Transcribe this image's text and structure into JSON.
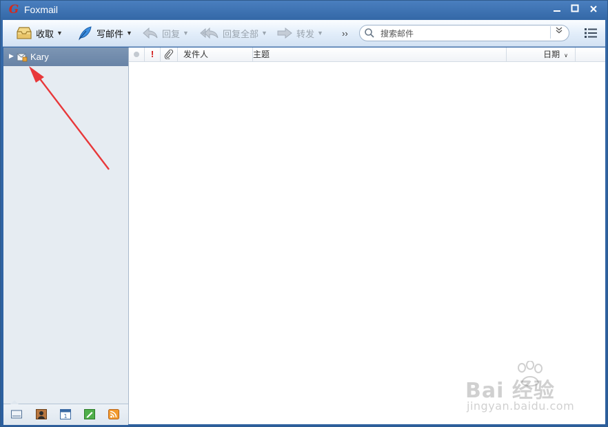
{
  "window": {
    "title": "Foxmail",
    "logo_glyph": "G",
    "controls": {
      "minimize": "▁",
      "maximize": "□",
      "close": "✕"
    }
  },
  "toolbar": {
    "receive": {
      "label": "收取",
      "icon": "inbox-tray-icon"
    },
    "compose": {
      "label": "写邮件",
      "icon": "feather-pen-icon"
    },
    "reply": {
      "label": "回复",
      "icon": "reply-arrow-icon",
      "enabled": false
    },
    "reply_all": {
      "label": "回复全部",
      "icon": "reply-all-arrow-icon",
      "enabled": false
    },
    "forward": {
      "label": "转发",
      "icon": "forward-arrow-icon",
      "enabled": false
    },
    "more": "››",
    "caret": "▼"
  },
  "search": {
    "placeholder": "搜索邮件",
    "value": "",
    "dropdown_glyph": "≽"
  },
  "sidebar": {
    "expander": "▶",
    "account": {
      "name": "Kary",
      "icon": "account-mailbox-icon"
    },
    "bottom_icons": [
      "mail-icon",
      "contacts-icon",
      "calendar-icon",
      "notes-icon",
      "rss-icon"
    ]
  },
  "message_list": {
    "columns": {
      "read": "",
      "flag": "!",
      "attachment": "",
      "from": "发件人",
      "subject": "主题",
      "date": "日期",
      "date_sort": "∨"
    },
    "rows": []
  },
  "watermark": {
    "main": "Bai  经验",
    "sub": "jingyan.baidu.com"
  },
  "colors": {
    "title_bar": "#3569a8",
    "account_row": "#6f88a9",
    "sidebar_bg": "#e6ecf2",
    "annotation_arrow": "#e8383a",
    "flag_red": "#d01010"
  }
}
